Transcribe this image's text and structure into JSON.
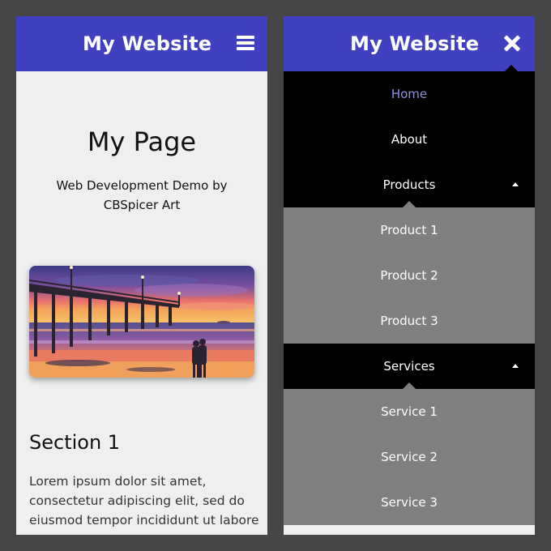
{
  "site_title": "My Website",
  "left_screen": {
    "page_title": "My Page",
    "subtitle": "Web Development Demo by CBSpicer Art",
    "section_heading": "Section 1",
    "body_text": "Lorem ipsum dolor sit amet, consectetur adipiscing elit, sed do eiusmod tempor incididunt ut labore"
  },
  "right_screen": {
    "menu": {
      "home": "Home",
      "about": "About",
      "products": "Products",
      "products_items": [
        "Product 1",
        "Product 2",
        "Product 3"
      ],
      "services": "Services",
      "services_items": [
        "Service 1",
        "Service 2",
        "Service 3"
      ]
    }
  },
  "colors": {
    "header_bg": "#4040c0",
    "active_link": "#8f8fe6",
    "menu_dark": "#000000",
    "submenu_grey": "#808080",
    "page_bg": "#efefef"
  },
  "icons": {
    "left_header": "hamburger-menu-icon",
    "right_header": "close-icon",
    "submenu_toggle": "caret-up-icon"
  }
}
